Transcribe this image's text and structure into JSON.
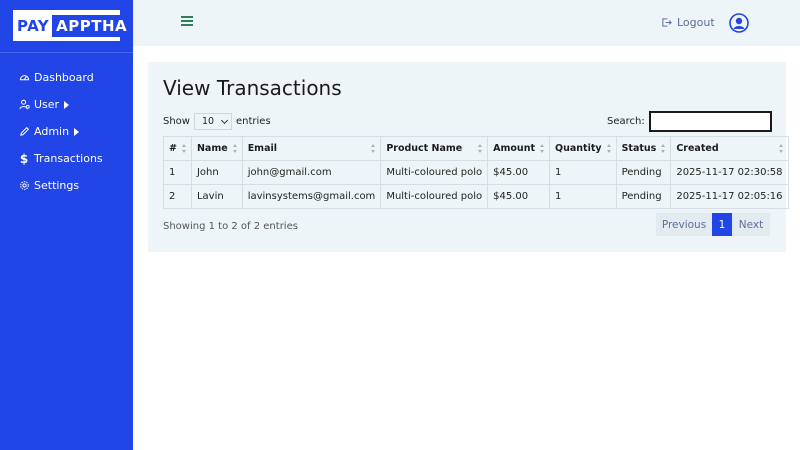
{
  "brand": {
    "pay": "PAY",
    "apptha": "APPTHA"
  },
  "sidebar": {
    "items": [
      {
        "label": "Dashboard",
        "icon": "dashboard-gauge-icon",
        "has_caret": false
      },
      {
        "label": "User",
        "icon": "users-icon",
        "has_caret": true
      },
      {
        "label": "Admin",
        "icon": "pencil-icon",
        "has_caret": true
      },
      {
        "label": "Transactions",
        "icon": "dollar-icon",
        "has_caret": false
      },
      {
        "label": "Settings",
        "icon": "gear-icon",
        "has_caret": false
      }
    ]
  },
  "topbar": {
    "logout_label": "Logout"
  },
  "main": {
    "title": "View Transactions",
    "show_label": "Show",
    "page_length": "10",
    "entries_label": "entries",
    "search_label": "Search:",
    "search_value": "",
    "columns": [
      "#",
      "Name",
      "Email",
      "Product Name",
      "Amount",
      "Quantity",
      "Status",
      "Created"
    ],
    "rows": [
      [
        "1",
        "John",
        "john@gmail.com",
        "Multi-coloured polo",
        "$45.00",
        "1",
        "Pending",
        "2025-11-17 02:30:58"
      ],
      [
        "2",
        "Lavin",
        "lavinsystems@gmail.com",
        "Multi-coloured polo",
        "$45.00",
        "1",
        "Pending",
        "2025-11-17 02:05:16"
      ]
    ],
    "info_text": "Showing 1 to 2 of 2 entries",
    "pagination": {
      "previous": "Previous",
      "current": "1",
      "next": "Next"
    }
  },
  "colors": {
    "sidebar_bg": "#2145e6",
    "topbar_bg": "#eef5f9",
    "accent": "#2145e6"
  }
}
